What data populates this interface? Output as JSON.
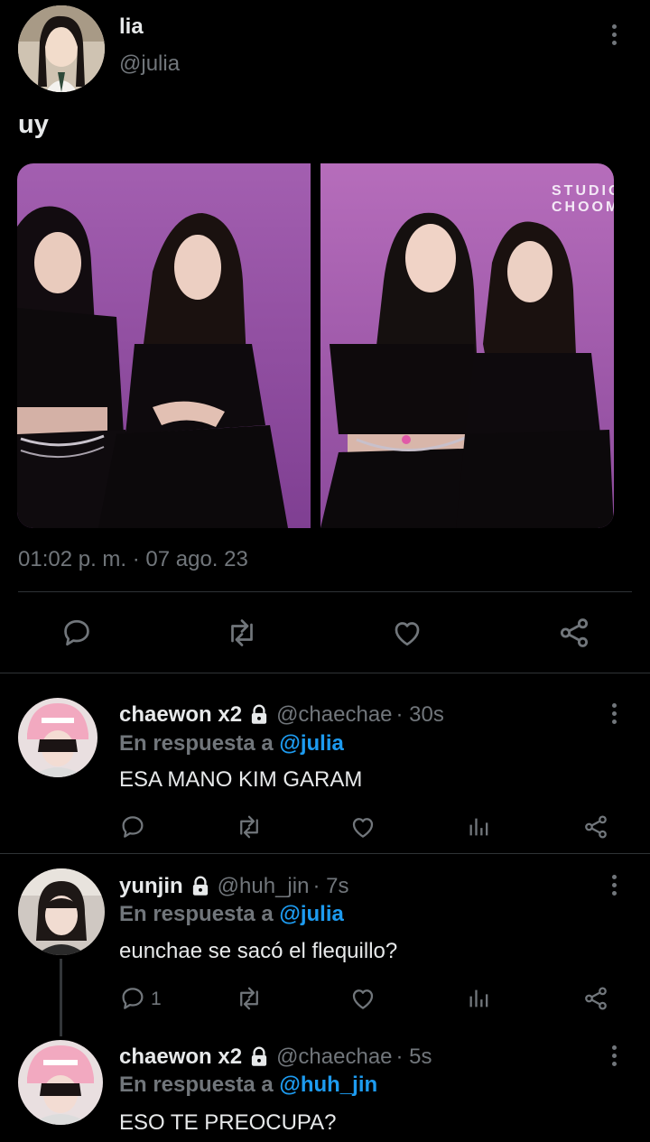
{
  "main_tweet": {
    "display_name": "lia",
    "handle": "@julia",
    "text": "uy",
    "timestamp": "01:02 p. m. · 07 ago. 23",
    "watermark": "STUDIO CHOOM"
  },
  "replies": [
    {
      "display_name": "chaewon x2",
      "locked": true,
      "handle": "@chaechae",
      "time": "· 30s",
      "reply_prefix": "En respuesta a",
      "reply_to": "@julia",
      "text": "ESA MANO KIM GARAM",
      "reply_count": ""
    },
    {
      "display_name": "yunjin",
      "locked": true,
      "handle": "@huh_jin",
      "time": "· 7s",
      "reply_prefix": "En respuesta a",
      "reply_to": "@julia",
      "text": "eunchae se sacó el flequillo?",
      "reply_count": "1"
    },
    {
      "display_name": "chaewon x2",
      "locked": true,
      "handle": "@chaechae",
      "time": "· 5s",
      "reply_prefix": "En respuesta a",
      "reply_to": "@huh_jin",
      "text": "ESO TE PREOCUPA?"
    }
  ],
  "colors": {
    "background": "#000000",
    "text": "#e7e9ea",
    "muted": "#71767b",
    "link": "#1d9bf0",
    "divider": "#2f3336"
  }
}
